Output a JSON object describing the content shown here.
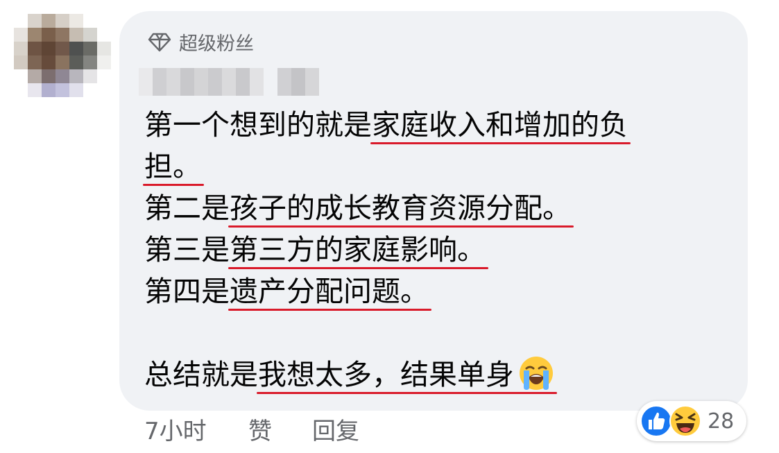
{
  "comment": {
    "badge_label": "超级粉丝",
    "badge_icon": "diamond-icon",
    "lines": [
      {
        "pre": "第一个想到的就是",
        "ul": "家庭收入和增加的负"
      },
      {
        "pre": "",
        "ul": "担。"
      },
      {
        "pre": "第二是",
        "ul": "孩子的成长教育资源分配。"
      },
      {
        "pre": "第三是",
        "ul": "第三方的家庭影响。"
      },
      {
        "pre": "第四是",
        "ul": "遗产分配问题。"
      }
    ],
    "summary": {
      "pre": "总结就是",
      "ul": "我想太多，结果单身",
      "emoji": "crying-face-emoji"
    }
  },
  "meta": {
    "time": "7小时",
    "like": "赞",
    "reply": "回复"
  },
  "reactions": {
    "icons": [
      "like-reaction-icon",
      "haha-reaction-icon"
    ],
    "count": "28"
  },
  "colors": {
    "bubble": "#f0f2f5",
    "underline": "#d91a2a",
    "like_blue": "#1877f2",
    "meta_text": "#65676b"
  }
}
